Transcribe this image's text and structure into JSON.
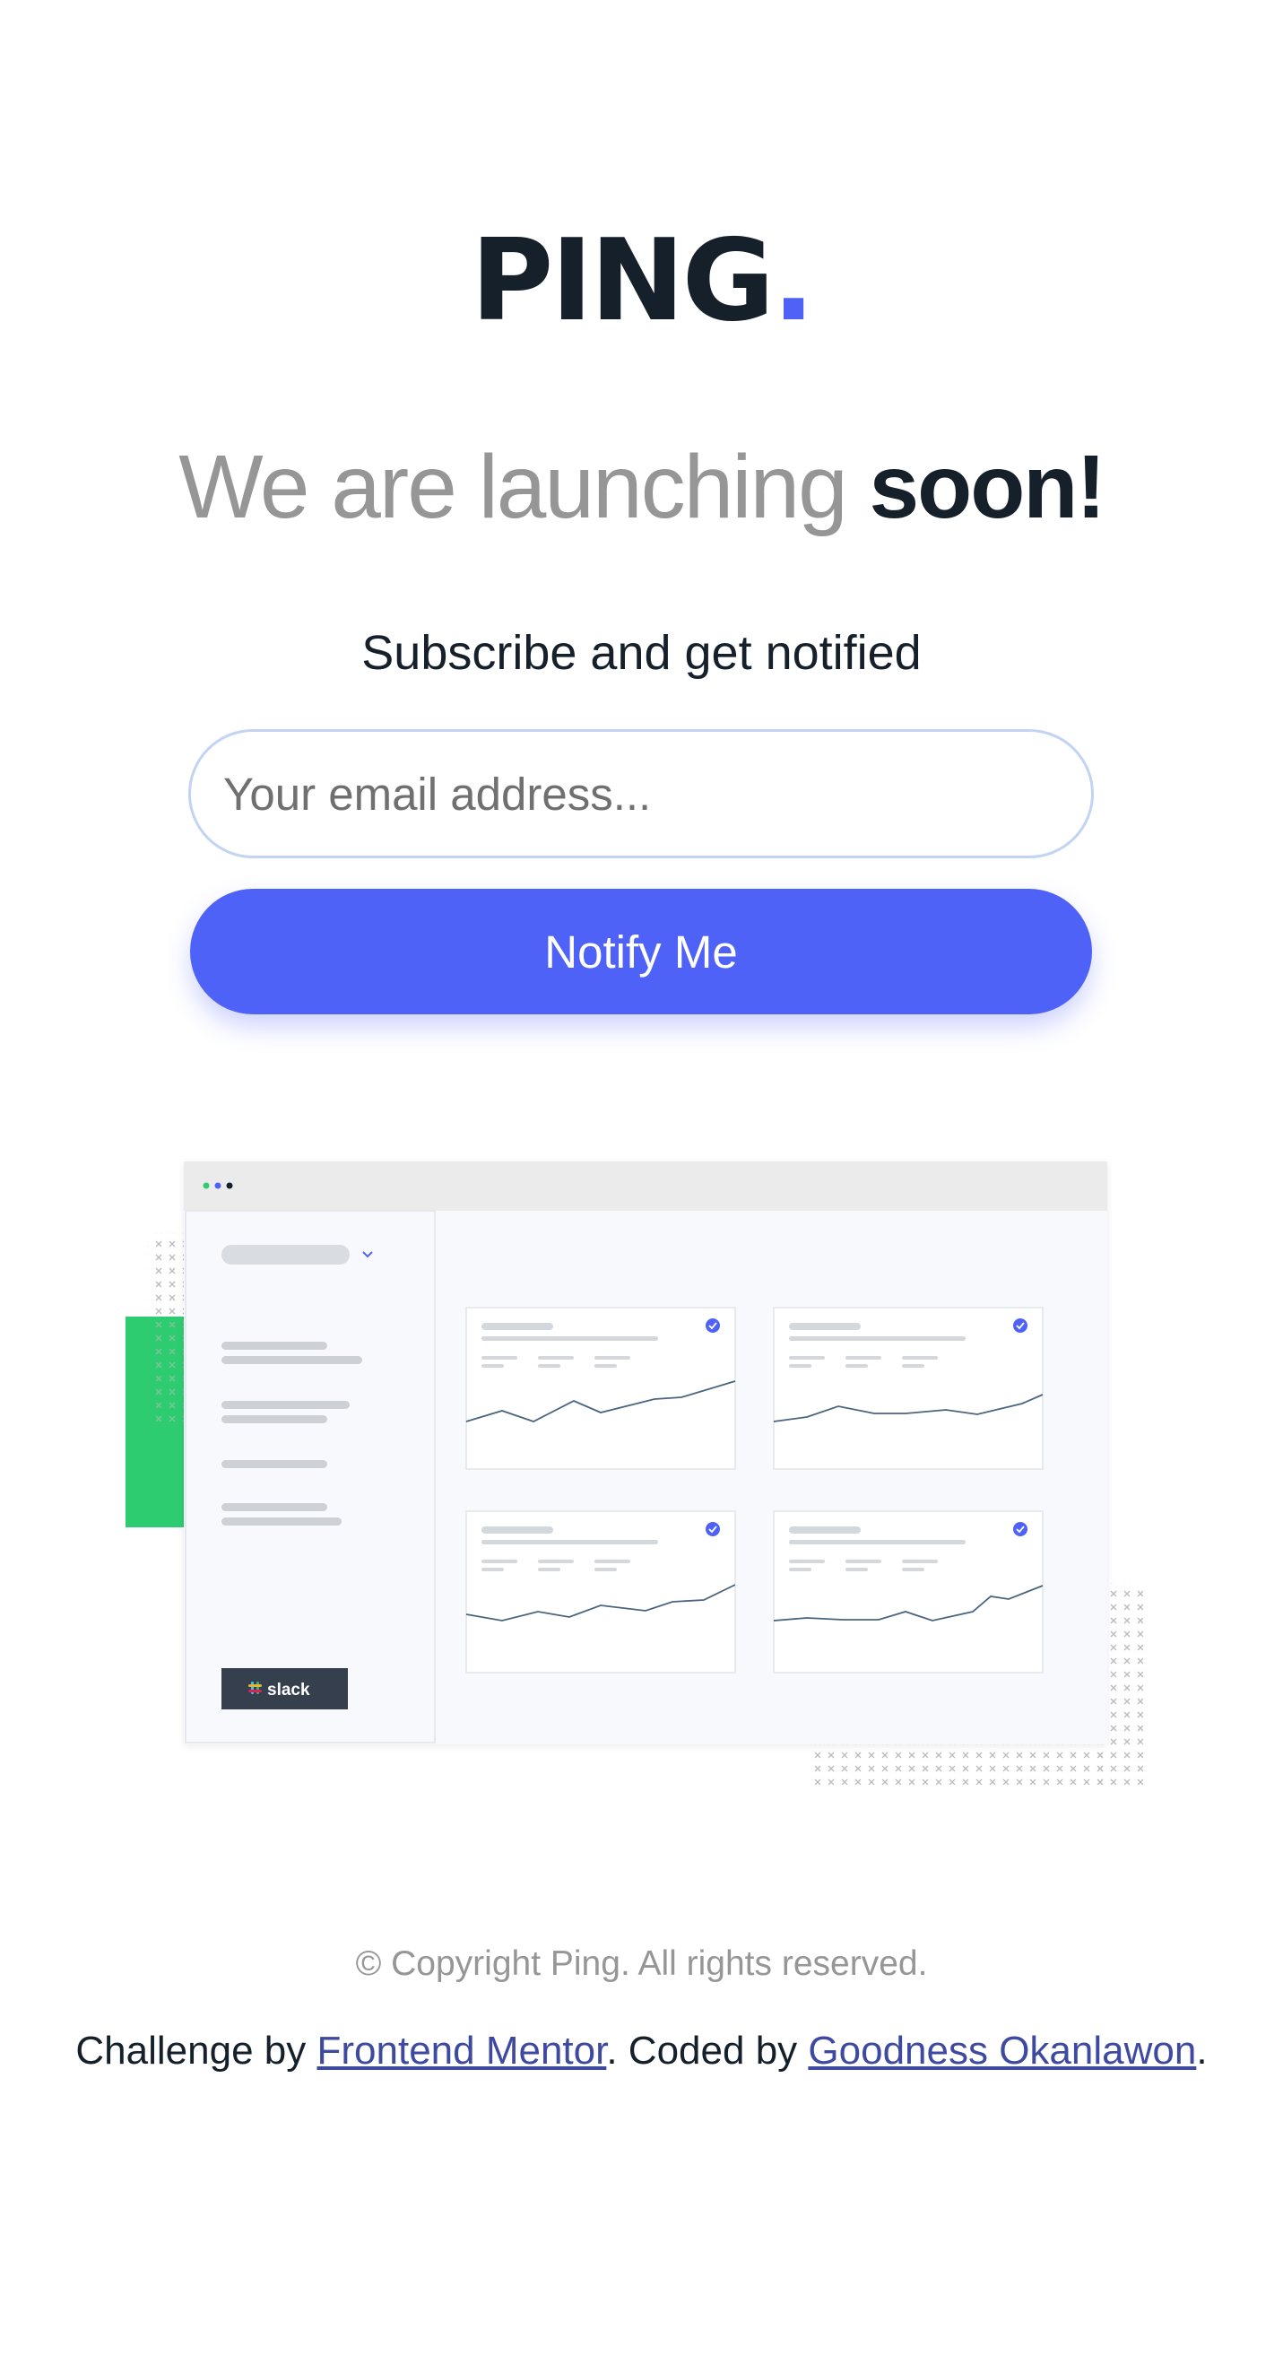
{
  "brand": {
    "name": "PING",
    "dot": "."
  },
  "headline": {
    "light": "We are launching",
    "bold": "soon!"
  },
  "subheading": "Subscribe and get notified",
  "form": {
    "email_placeholder": "Your email address...",
    "email_value": "",
    "submit_label": "Notify Me"
  },
  "illustration": {
    "badge": "slack"
  },
  "footer": {
    "copyright": "© Copyright Ping. All rights reserved.",
    "credits_prefix": "Challenge by",
    "frontend_mentor": "Frontend Mentor",
    "coded_by": ". Coded by",
    "author": "Goodness Okanlawon",
    "suffix": "."
  },
  "colors": {
    "brand_blue": "#4f62f7",
    "dark_text": "#15202b",
    "gray_text": "#969696",
    "input_border": "#c2d3f3",
    "accent_green": "#2ecc71",
    "link": "#3e4aa0"
  }
}
